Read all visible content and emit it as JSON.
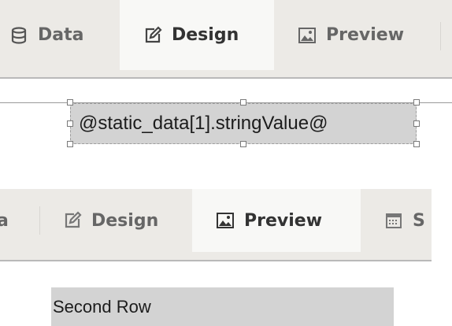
{
  "top_tabs": {
    "data_label": "Data",
    "design_label": "Design",
    "preview_label": "Preview",
    "active": "Design"
  },
  "design": {
    "field_expression": "@static_data[1].stringValue@"
  },
  "bottom_tabs": {
    "data_label_partial": "a",
    "design_label": "Design",
    "preview_label": "Preview",
    "schedule_label_partial": "S",
    "active": "Preview"
  },
  "preview": {
    "row_text": "Second Row"
  },
  "icons": {
    "data": "database-icon",
    "design": "edit-icon",
    "preview": "image-icon",
    "schedule": "calendar-icon"
  }
}
